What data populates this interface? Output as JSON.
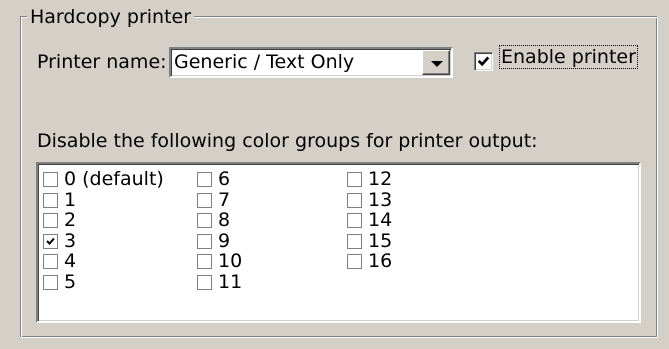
{
  "group": {
    "title": "Hardcopy printer"
  },
  "printer": {
    "label": "Printer name:",
    "selected": "Generic / Text Only",
    "enable_label": "Enable printer",
    "enable_checked": true
  },
  "colors": {
    "heading": "Disable the following color groups for printer output:",
    "items": [
      {
        "label": "0 (default)",
        "checked": false
      },
      {
        "label": "1",
        "checked": false
      },
      {
        "label": "2",
        "checked": false
      },
      {
        "label": "3",
        "checked": true
      },
      {
        "label": "4",
        "checked": false
      },
      {
        "label": "5",
        "checked": false
      },
      {
        "label": "6",
        "checked": false
      },
      {
        "label": "7",
        "checked": false
      },
      {
        "label": "8",
        "checked": false
      },
      {
        "label": "9",
        "checked": false
      },
      {
        "label": "10",
        "checked": false
      },
      {
        "label": "11",
        "checked": false
      },
      {
        "label": "12",
        "checked": false
      },
      {
        "label": "13",
        "checked": false
      },
      {
        "label": "14",
        "checked": false
      },
      {
        "label": "15",
        "checked": false
      },
      {
        "label": "16",
        "checked": false
      }
    ]
  },
  "theme": {
    "face": "#d4d0c8",
    "shadow": "#808080",
    "highlight": "#ffffff",
    "window": "#ffffff"
  }
}
